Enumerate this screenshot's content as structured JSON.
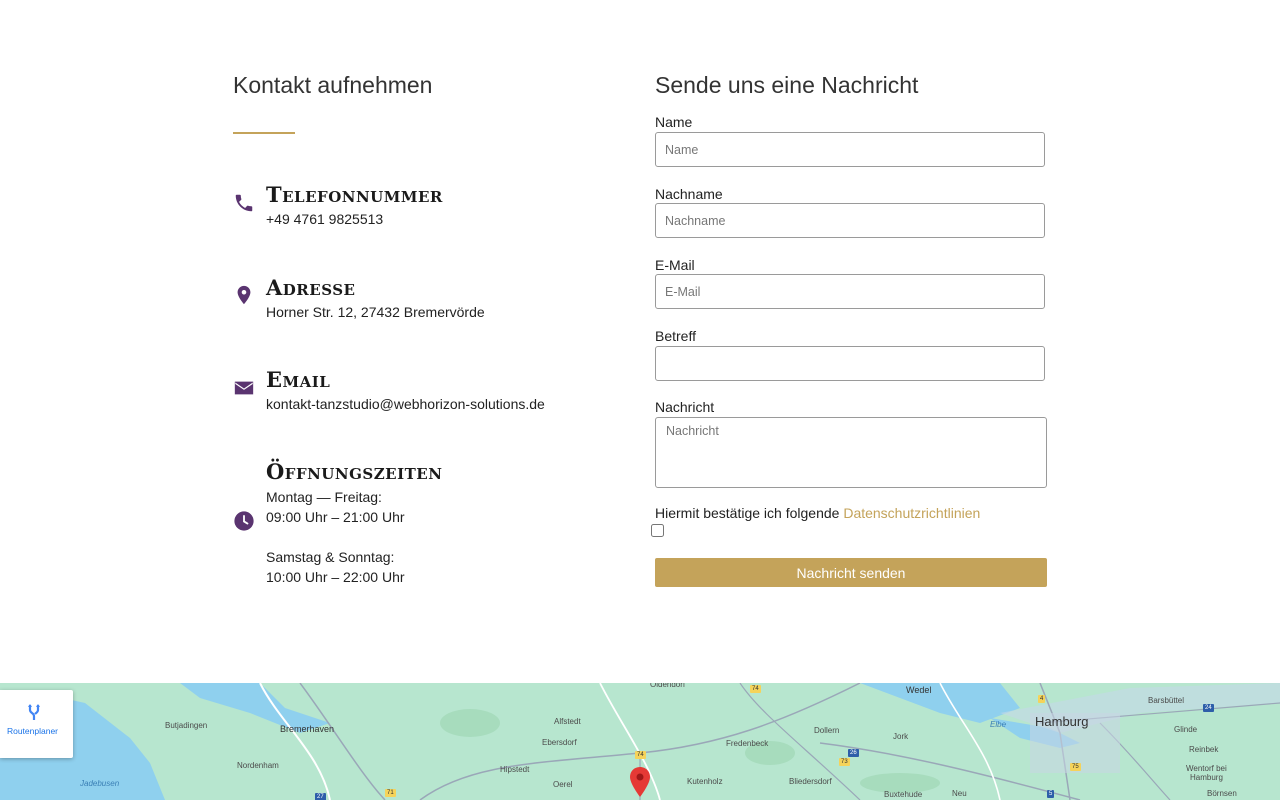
{
  "contact": {
    "title": "Kontakt aufnehmen",
    "phone": {
      "heading": "Telefonnummer",
      "value": "+49 4761 9825513",
      "icon": "phone-icon"
    },
    "address": {
      "heading": "Adresse",
      "value": "Horner Str. 12, 27432 Bremervörde",
      "icon": "map-marker-icon"
    },
    "email": {
      "heading": "Email",
      "value": "kontakt-tanzstudio@webhorizon-solutions.de",
      "icon": "envelope-icon"
    },
    "hours": {
      "heading": "Öffnungszeiten",
      "icon": "clock-icon",
      "weekday_label": "Montag — Freitag:",
      "weekday_time": "09:00 Uhr – 21:00 Uhr",
      "weekend_label": "Samstag & Sonntag:",
      "weekend_time": "10:00 Uhr – 22:00 Uhr"
    }
  },
  "form": {
    "title": "Sende uns eine Nachricht",
    "name_label": "Name",
    "name_placeholder": "Name",
    "lastname_label": "Nachname",
    "lastname_placeholder": "Nachname",
    "email_label": "E-Mail",
    "email_placeholder": "E-Mail",
    "subject_label": "Betreff",
    "subject_placeholder": "",
    "message_label": "Nachricht",
    "message_placeholder": "Nachricht",
    "consent_text": "Hiermit bestätige ich folgende ",
    "consent_link": "Datenschutzrichtlinien",
    "consent_checked": false,
    "submit_label": "Nachricht senden"
  },
  "map": {
    "route_planner_label": "Routenplaner",
    "route_icon": "directions-icon",
    "pin_icon": "map-pin-icon",
    "places": [
      "Oldendorf",
      "Wedel",
      "Barsbüttel",
      "Hamburg",
      "Butjadingen",
      "Bremerhaven",
      "Alfstedt",
      "Ebersdorf",
      "Fredenbeck",
      "Dollern",
      "Jork",
      "Glinde",
      "Reinbek",
      "Nordenham",
      "Hipstedt",
      "Kutenholz",
      "Bliedersdorf",
      "Wentorf bei Hamburg",
      "Jadebusen",
      "Oerel",
      "Buxtehude",
      "Neu",
      "Börnsen",
      "Elbe"
    ],
    "road_numbers": [
      "74",
      "4",
      "24",
      "26",
      "73",
      "75",
      "27",
      "71",
      "5"
    ],
    "colors": {
      "land": "#b7e6cf",
      "water": "#8fd0ee",
      "pin": "#e53935"
    }
  },
  "colors": {
    "accent_gold": "#c4a35a",
    "icon_purple": "#5a3470"
  }
}
